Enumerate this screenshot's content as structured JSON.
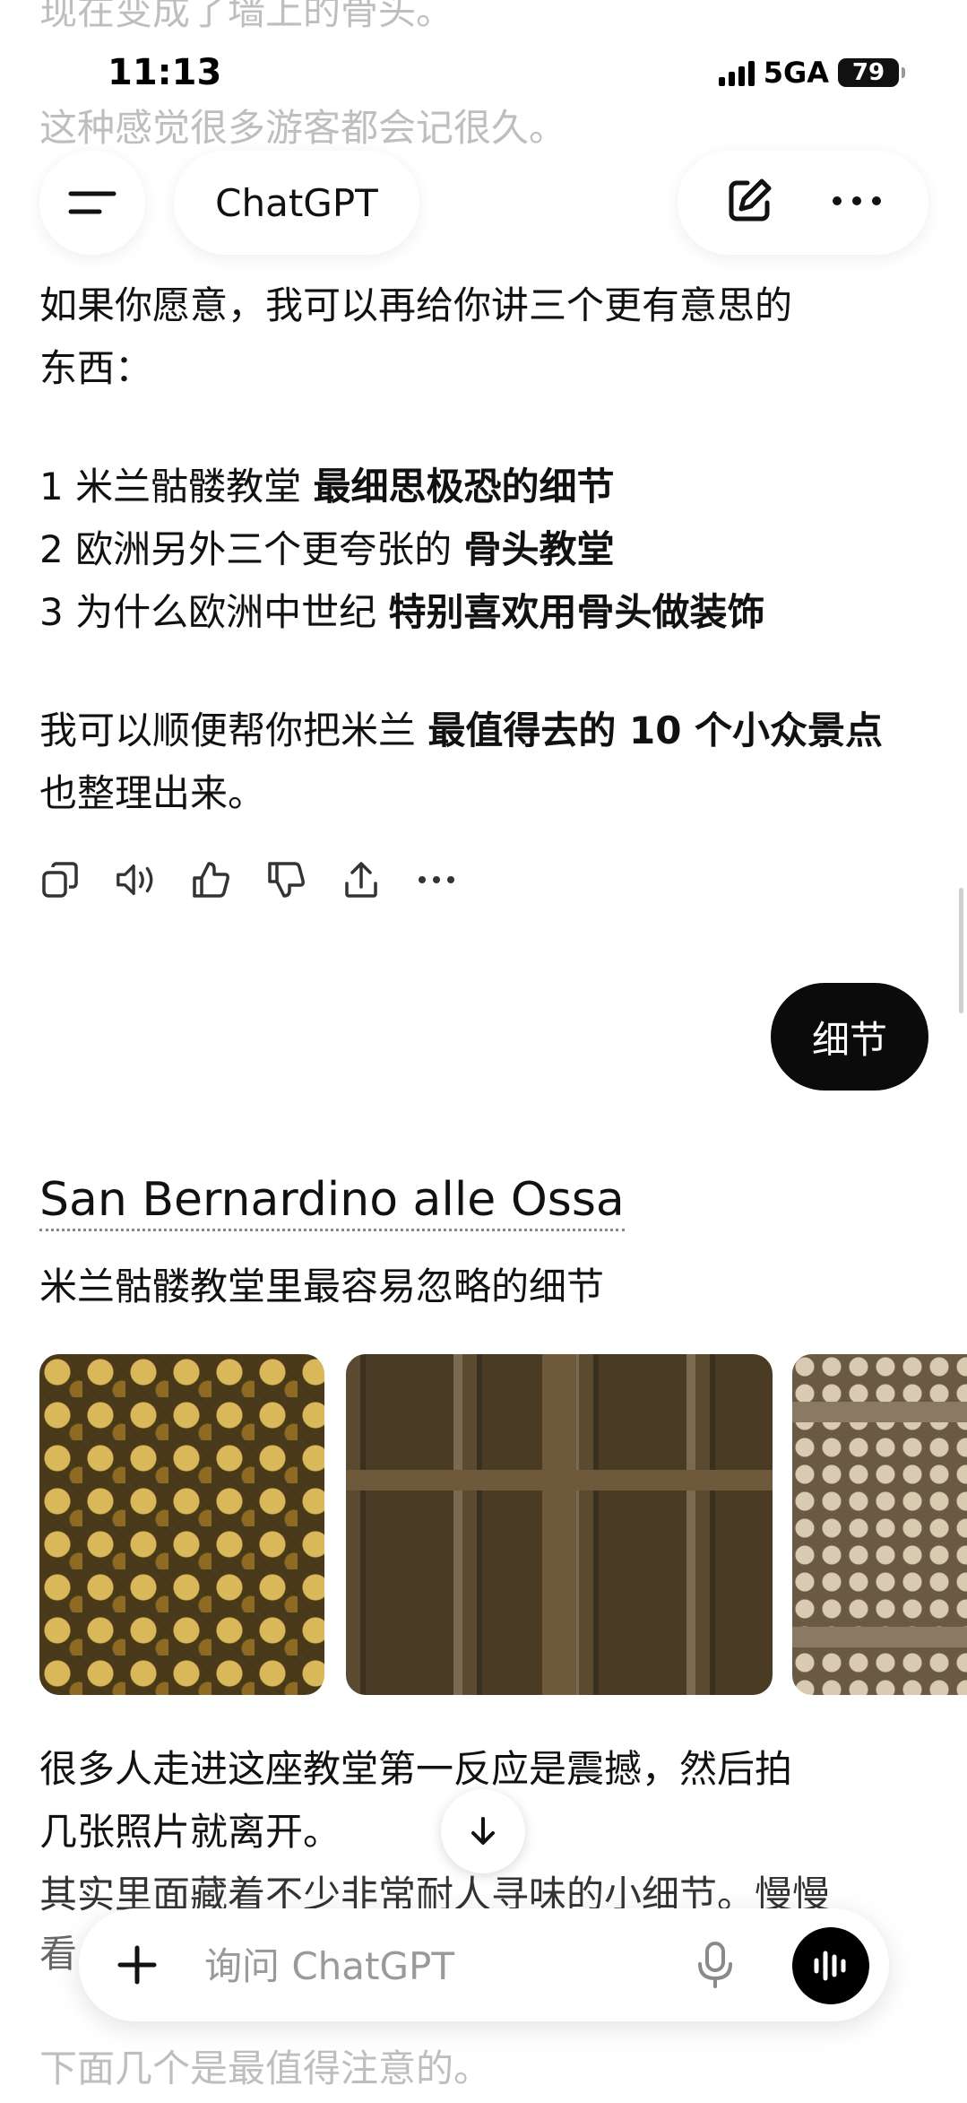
{
  "status_bar": {
    "time": "11:13",
    "network": "5GA",
    "battery": "79"
  },
  "header": {
    "model_label": "ChatGPT"
  },
  "faded_top": {
    "line1": "现在变成了墙上的骨头。",
    "line2": "这种感觉很多游客都会记很久。"
  },
  "assistant_message_1": {
    "intro_line1": "如果你愿意，我可以再给你讲三个更有意思的",
    "intro_line2": "东西：",
    "items": [
      {
        "prefix": "1 米兰骷髅教堂 ",
        "bold": "最细思极恐的细节"
      },
      {
        "prefix": "2 欧洲另外三个更夸张的 ",
        "bold": "骨头教堂"
      },
      {
        "prefix": "3 为什么欧洲中世纪 ",
        "bold": "特别喜欢用骨头做装饰"
      }
    ],
    "offer_prefix": "我可以顺便帮你把米兰 ",
    "offer_bold": "最值得去的 10 个小众景点",
    "offer_line2": "也整理出来。"
  },
  "action_icons": [
    "copy-icon",
    "speaker-icon",
    "thumbs-up-icon",
    "thumbs-down-icon",
    "share-icon",
    "more-icon"
  ],
  "user_message": {
    "text": "细节"
  },
  "assistant_message_2": {
    "heading": "San Bernardino alle Ossa",
    "subtitle": "米兰骷髅教堂里最容易忽略的细节",
    "images": [
      "skull-wall-image",
      "bone-cross-image",
      "skull-shelf-image"
    ],
    "para_line1": "很多人走进这座教堂第一反应是震撼，然后拍",
    "para_line2": "几张照片就离开。",
    "para_line3": "其实里面藏着不少非常耐人寻味的小细节。慢慢",
    "para_line4_visible": "看",
    "para_line5": "下面几个是最值得注意的。"
  },
  "composer": {
    "placeholder": "询问 ChatGPT"
  }
}
